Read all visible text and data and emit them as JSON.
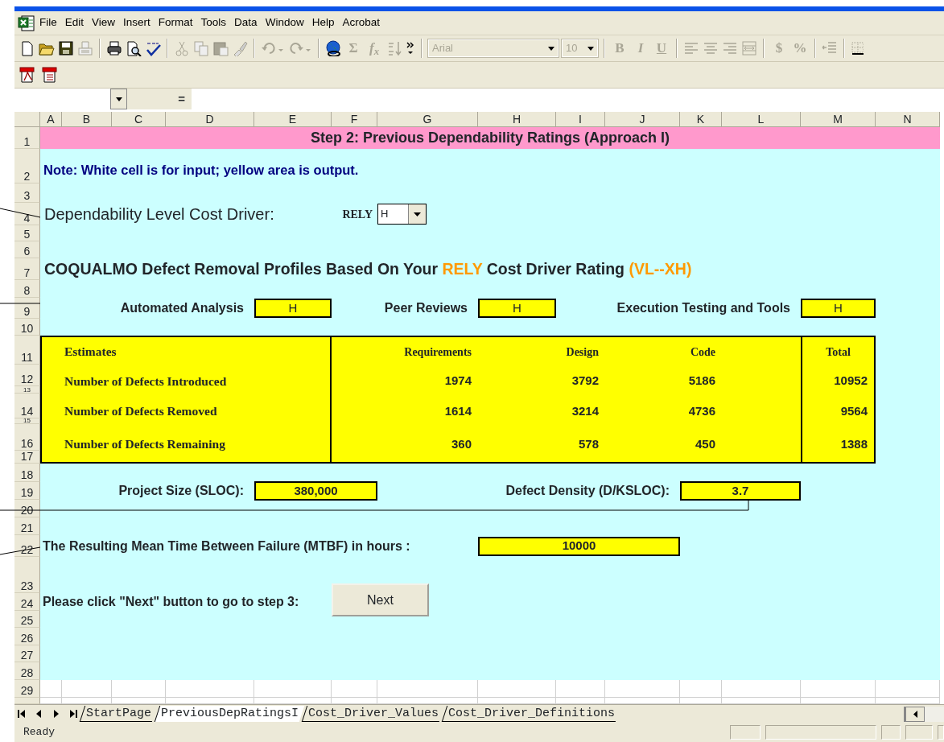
{
  "menu": [
    "File",
    "Edit",
    "View",
    "Insert",
    "Format",
    "Tools",
    "Data",
    "Window",
    "Help",
    "Acrobat"
  ],
  "standard_toolbar": {
    "glyph_buttons": [
      {
        "label": "Σ",
        "disabled": true
      },
      {
        "label": "f$_{x}$",
        "disabled": true
      }
    ]
  },
  "formatting_toolbar": {
    "font": "Arial",
    "size": "10",
    "disabled": true,
    "glyph_buttons": [
      {
        "label": "B",
        "disabled": true
      },
      {
        "label": "I",
        "disabled": true
      },
      {
        "label": "U",
        "disabled": true
      },
      {
        "label": "$",
        "disabled": true
      },
      {
        "label": "%",
        "disabled": true
      }
    ]
  },
  "formula_bar": {
    "equals": "="
  },
  "columns": [
    "A",
    "B",
    "C",
    "D",
    "E",
    "F",
    "G",
    "H",
    "I",
    "J",
    "K",
    "L",
    "M",
    "N"
  ],
  "rows": [
    "1",
    "2",
    "3",
    "4",
    "5",
    "6",
    "7",
    "8",
    "9",
    "10",
    "11",
    "12",
    "13",
    "14",
    "15",
    "16",
    "17",
    "18",
    "19",
    "20",
    "21",
    "22",
    "23",
    "24",
    "25",
    "26",
    "27",
    "28",
    "29"
  ],
  "sheet": {
    "title": "Step 2: Previous Dependability Ratings (Approach I)",
    "note": "Note: White cell is for input; yellow area is output.",
    "driver_label": "Dependability Level Cost Driver:",
    "driver_select": {
      "label": "RELY",
      "value": "H"
    },
    "profiles_heading": [
      {
        "text": "COQUALMO Defect Removal Profiles Based On Your ",
        "accent": false
      },
      {
        "text": "RELY",
        "accent": true
      },
      {
        "text": " Cost Driver Rating ",
        "accent": false
      },
      {
        "text": "(VL--XH)",
        "accent": true
      }
    ],
    "profiles": [
      {
        "label": "Automated Analysis",
        "value": "H"
      },
      {
        "label": "Peer Reviews",
        "value": "H"
      },
      {
        "label": "Execution Testing and Tools",
        "value": "H"
      }
    ],
    "estimates": {
      "columns": [
        "Estimates",
        "Requirements",
        "Design",
        "Code",
        "Total"
      ],
      "rows": [
        [
          "Number of Defects Introduced",
          "1974",
          "3792",
          "5186",
          "10952"
        ],
        [
          "Number of Defects Removed",
          "1614",
          "3214",
          "4736",
          "9564"
        ],
        [
          "Number of Defects Remaining",
          "360",
          "578",
          "450",
          "1388"
        ]
      ]
    },
    "project_size": {
      "label": "Project Size (SLOC):",
      "value": "380,000"
    },
    "defect_density": {
      "label": "Defect Density (D/KSLOC):",
      "value": "3.7"
    },
    "mtbf": {
      "label": "The Resulting Mean Time Between Failure (MTBF) in hours :",
      "value": "10000"
    },
    "next_prompt": "Please click \"Next\" button to go to step 3:",
    "next_button": "Next"
  },
  "sheet_tabs": [
    {
      "label": "StartPage",
      "selected": false
    },
    {
      "label": "PreviousDepRatingsI",
      "selected": true
    },
    {
      "label": "Cost_Driver_Values",
      "selected": false
    },
    {
      "label": "Cost_Driver_Definitions",
      "selected": false
    }
  ],
  "status_bar": {
    "text": "Ready"
  }
}
